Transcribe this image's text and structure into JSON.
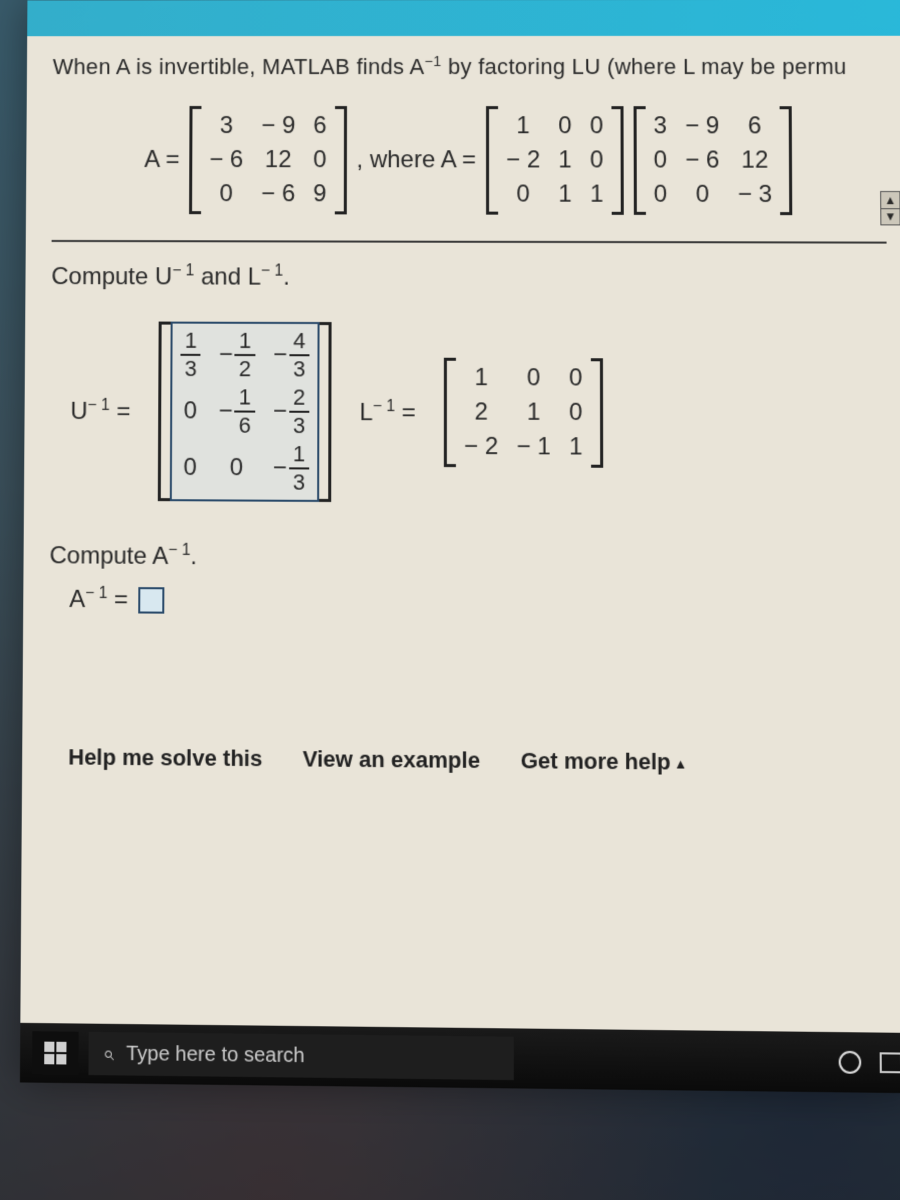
{
  "intro": {
    "line": "When A is invertible, MATLAB finds A",
    "exp": "−1",
    "rest": " by factoring LU (where L may be permu"
  },
  "eq1": {
    "A_label": "A =",
    "A": [
      "3",
      "− 9",
      "6",
      "− 6",
      "12",
      "0",
      "0",
      "− 6",
      "9"
    ],
    "where": ", where A =",
    "L": [
      "1",
      "0",
      "0",
      "− 2",
      "1",
      "0",
      "0",
      "1",
      "1"
    ],
    "U": [
      "3",
      "− 9",
      "6",
      "0",
      "− 6",
      "12",
      "0",
      "0",
      "− 3"
    ]
  },
  "sub1": {
    "p1": "Compute U",
    "e1": "− 1",
    "p2": " and L",
    "e2": "− 1",
    "p3": "."
  },
  "Uinv": {
    "label_pre": "U",
    "label_exp": "− 1",
    "label_eq": " =",
    "cells": {
      "r0c0": {
        "num": "1",
        "den": "3"
      },
      "r0c1": {
        "sign": "−",
        "num": "1",
        "den": "2"
      },
      "r0c2": {
        "sign": "−",
        "num": "4",
        "den": "3"
      },
      "r1c0": "0",
      "r1c1": {
        "sign": "−",
        "num": "1",
        "den": "6"
      },
      "r1c2": {
        "sign": "−",
        "num": "2",
        "den": "3"
      },
      "r2c0": "0",
      "r2c1": "0",
      "r2c2": {
        "sign": "−",
        "num": "1",
        "den": "3"
      }
    }
  },
  "Linv": {
    "label_pre": "L",
    "label_exp": "− 1",
    "label_eq": " =",
    "cells": [
      "1",
      "0",
      "0",
      "2",
      "1",
      "0",
      "− 2",
      "− 1",
      "1"
    ]
  },
  "sub2": {
    "p1": "Compute A",
    "e1": "− 1",
    "p2": "."
  },
  "ainv": {
    "p1": "A",
    "e1": "− 1",
    "eq": " ="
  },
  "help": {
    "solve": "Help me solve this",
    "view": "View an example",
    "more": "Get more help",
    "caret": "▴"
  },
  "taskbar": {
    "search_placeholder": "Type here to search"
  }
}
